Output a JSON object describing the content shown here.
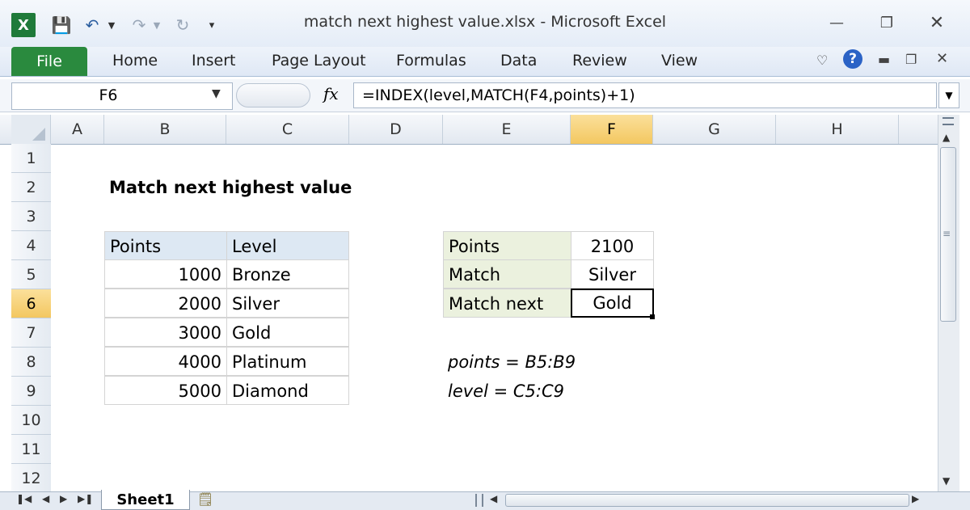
{
  "window": {
    "title": "match next highest value.xlsx  -  Microsoft Excel"
  },
  "ribbon": {
    "file_tab": "File",
    "tabs": [
      "Home",
      "Insert",
      "Page Layout",
      "Formulas",
      "Data",
      "Review",
      "View"
    ],
    "help_glyph": "?"
  },
  "formula_bar": {
    "name_box": "F6",
    "fx_label": "fx",
    "formula": "=INDEX(level,MATCH(F4,points)+1)"
  },
  "grid": {
    "columns": [
      "A",
      "B",
      "C",
      "D",
      "E",
      "F",
      "G",
      "H"
    ],
    "rows": [
      "1",
      "2",
      "3",
      "4",
      "5",
      "6",
      "7",
      "8",
      "9",
      "10",
      "11",
      "12"
    ],
    "selected_column": "F",
    "selected_row": "6"
  },
  "sheet": {
    "title": "Match next highest value",
    "table": {
      "headers": [
        "Points",
        "Level"
      ],
      "rows": [
        [
          "1000",
          "Bronze"
        ],
        [
          "2000",
          "Silver"
        ],
        [
          "3000",
          "Gold"
        ],
        [
          "4000",
          "Platinum"
        ],
        [
          "5000",
          "Diamond"
        ]
      ]
    },
    "lookup": {
      "labels": [
        "Points",
        "Match",
        "Match next"
      ],
      "values": [
        "2100",
        "Silver",
        "Gold"
      ]
    },
    "notes": [
      "points = B5:B9",
      "level = C5:C9"
    ]
  },
  "tabs_bottom": {
    "sheet_name": "Sheet1"
  },
  "colors": {
    "file_tab": "#2a8a3e",
    "header_blue": "#dde8f3",
    "header_green": "#ebf1de",
    "selected_header": "#f3c760"
  },
  "icons": {
    "excel_logo": "excel-logo-icon",
    "save": "save-icon",
    "undo": "undo-icon",
    "redo": "redo-icon",
    "repeat": "repeat-icon",
    "help": "help-icon"
  }
}
